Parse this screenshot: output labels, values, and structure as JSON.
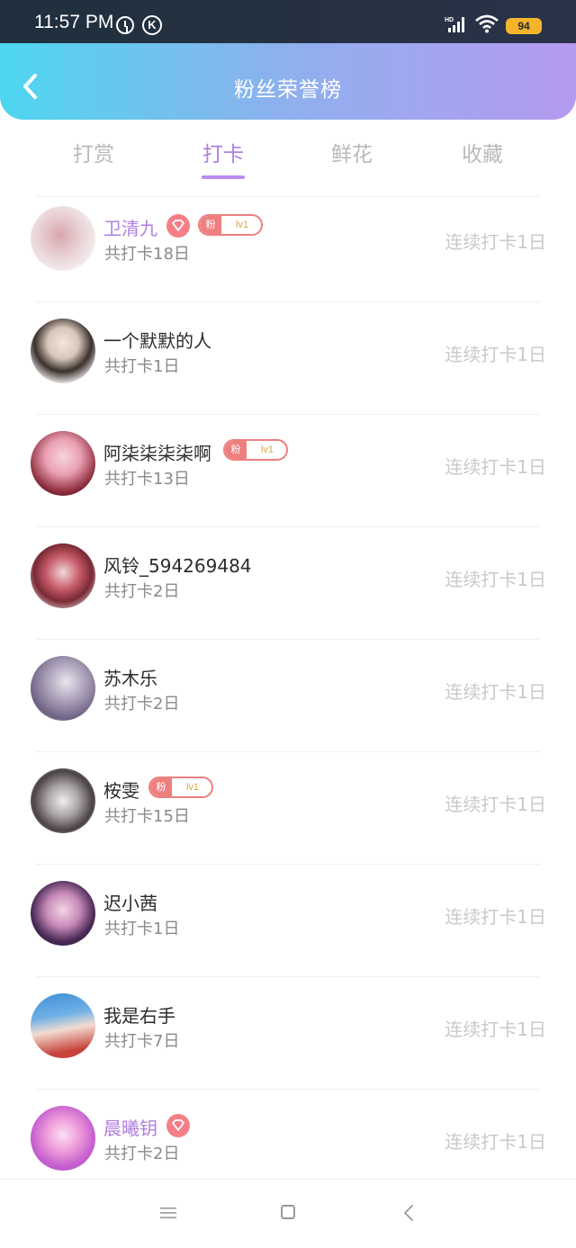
{
  "status_bar": {
    "time": "11:57 PM",
    "battery": "94",
    "signal_label": "HD",
    "icons": [
      "alarm-icon",
      "k-app-icon",
      "signal-icon",
      "wifi-icon",
      "battery-icon"
    ]
  },
  "header": {
    "title": "粉丝荣誉榜",
    "back_icon": "chevron-left-icon",
    "gradient": [
      "#4dd6ef",
      "#b59af0"
    ]
  },
  "tabs": [
    {
      "label": "打赏",
      "active": false
    },
    {
      "label": "打卡",
      "active": true
    },
    {
      "label": "鲜花",
      "active": false
    },
    {
      "label": "收藏",
      "active": false
    }
  ],
  "accent_color": "#b07fe0",
  "fan_badge": {
    "label": "粉",
    "level": "lv1"
  },
  "rows": [
    {
      "name": "卫清九",
      "total": "共打卡18日",
      "streak": "连续打卡1日",
      "vip": true,
      "fan_badge": true
    },
    {
      "name": "一个默默的人",
      "total": "共打卡1日",
      "streak": "连续打卡1日",
      "vip": false,
      "fan_badge": false
    },
    {
      "name": "阿柒柒柒柒啊",
      "total": "共打卡13日",
      "streak": "连续打卡1日",
      "vip": false,
      "fan_badge": true
    },
    {
      "name": "风铃_594269484",
      "total": "共打卡2日",
      "streak": "连续打卡1日",
      "vip": false,
      "fan_badge": false
    },
    {
      "name": "苏木乐",
      "total": "共打卡2日",
      "streak": "连续打卡1日",
      "vip": false,
      "fan_badge": false
    },
    {
      "name": "桉雯",
      "total": "共打卡15日",
      "streak": "连续打卡1日",
      "vip": false,
      "fan_badge": true
    },
    {
      "name": "迟小茜",
      "total": "共打卡1日",
      "streak": "连续打卡1日",
      "vip": false,
      "fan_badge": false
    },
    {
      "name": "我是右手",
      "total": "共打卡7日",
      "streak": "连续打卡1日",
      "vip": false,
      "fan_badge": false
    },
    {
      "name": "晨曦钥",
      "total": "共打卡2日",
      "streak": "连续打卡1日",
      "vip": true,
      "fan_badge": false
    }
  ],
  "nav": [
    "menu-icon",
    "home-icon",
    "back-icon"
  ]
}
